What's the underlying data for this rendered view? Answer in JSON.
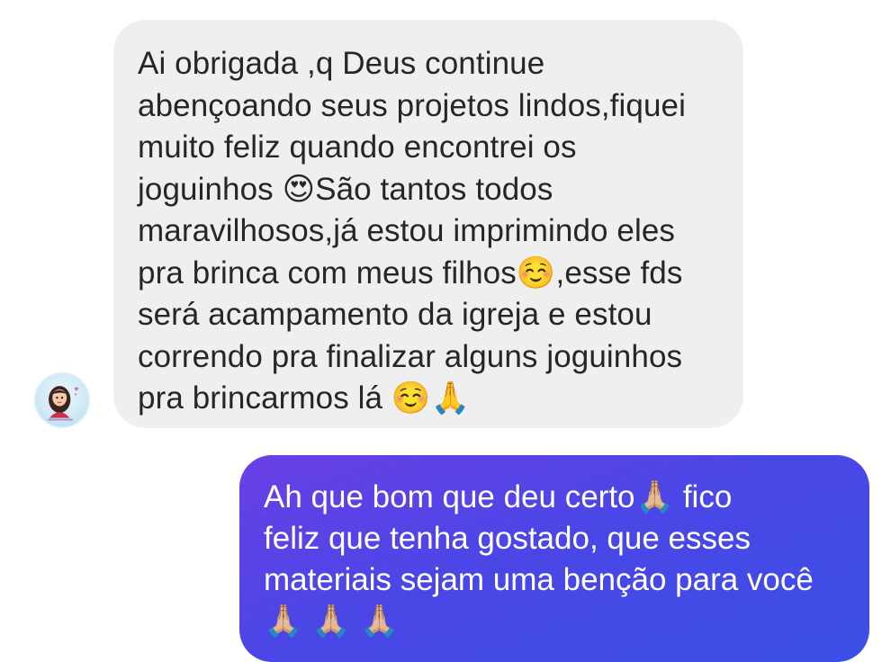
{
  "conversation": {
    "incoming": {
      "avatar_icon": "user-avatar-icon",
      "text": "Ai obrigada ,q Deus continue\nabençoando seus projetos lindos,fiquei\nmuito feliz quando encontrei os\njoguinhos 😍São tantos  todos\nmaravilhosos,já estou imprimindo eles\npra brinca com meus filhos☺️,esse fds\nserá acampamento da igreja e estou\ncorrendo pra finalizar alguns joguinhos\npra brincarmos lá ☺️🙏"
    },
    "outgoing": {
      "text": "Ah que bom que deu certo🙏🏼 fico\nfeliz que tenha gostado, que esses\nmateriais sejam uma benção para você\n🙏🏼 🙏🏼 🙏🏼"
    }
  },
  "colors": {
    "incoming_bubble": "#efefef",
    "incoming_text": "#262626",
    "outgoing_gradient_start": "#6a3fe6",
    "outgoing_gradient_end": "#3a4fe6",
    "outgoing_text": "#ffffff"
  }
}
